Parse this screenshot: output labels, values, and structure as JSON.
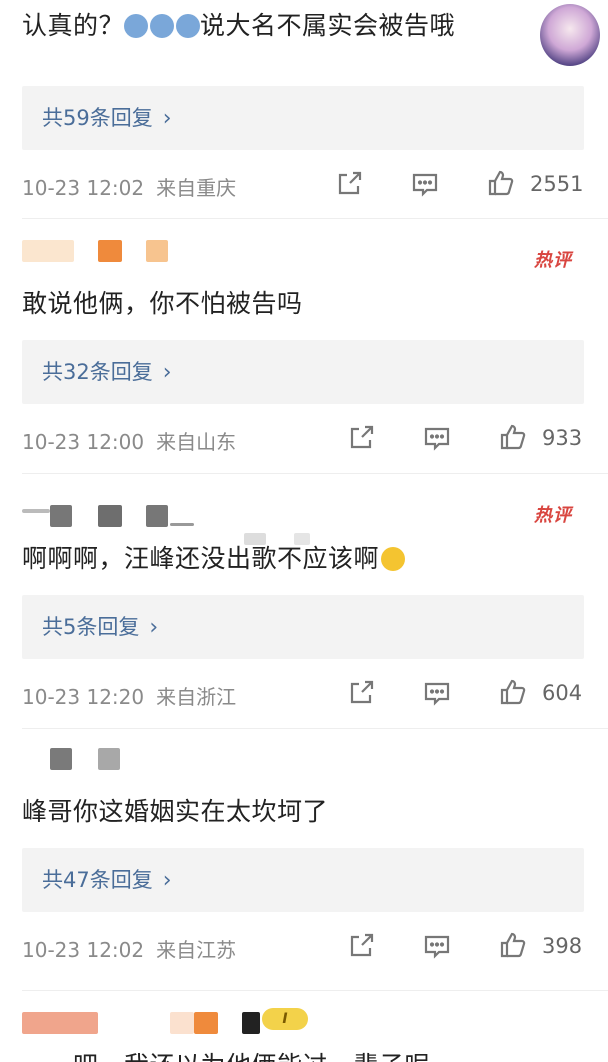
{
  "top": {
    "text": "认真的？",
    "text_after": "说大名不属实会被告哦",
    "replies": "共59条回复",
    "time": "10-23 12:02",
    "source": "来自重庆",
    "likes": "2551"
  },
  "comments": [
    {
      "badge": "热评",
      "text": "敢说他俩，你不怕被告吗",
      "replies": "共32条回复",
      "time": "10-23 12:00",
      "source": "来自山东",
      "likes": "933"
    },
    {
      "badge": "热评",
      "text": "啊啊啊，汪峰还没出歌不应该啊",
      "replies": "共5条回复",
      "time": "10-23 12:20",
      "source": "来自浙江",
      "likes": "604"
    },
    {
      "text": "峰哥你这婚姻实在太坎坷了",
      "replies": "共47条回复",
      "time": "10-23 12:02",
      "source": "来自江苏",
      "likes": "398"
    }
  ],
  "partial_bottom_text": "……吧，我还以为他俩能过一辈子呢",
  "colors": {
    "link": "#4a6d99",
    "meta": "#8a8a8a",
    "hot": "#d94640",
    "reply_bg": "#f3f3f3"
  },
  "icons": [
    "share-icon",
    "comment-icon",
    "like-icon",
    "chevron-right-icon"
  ]
}
